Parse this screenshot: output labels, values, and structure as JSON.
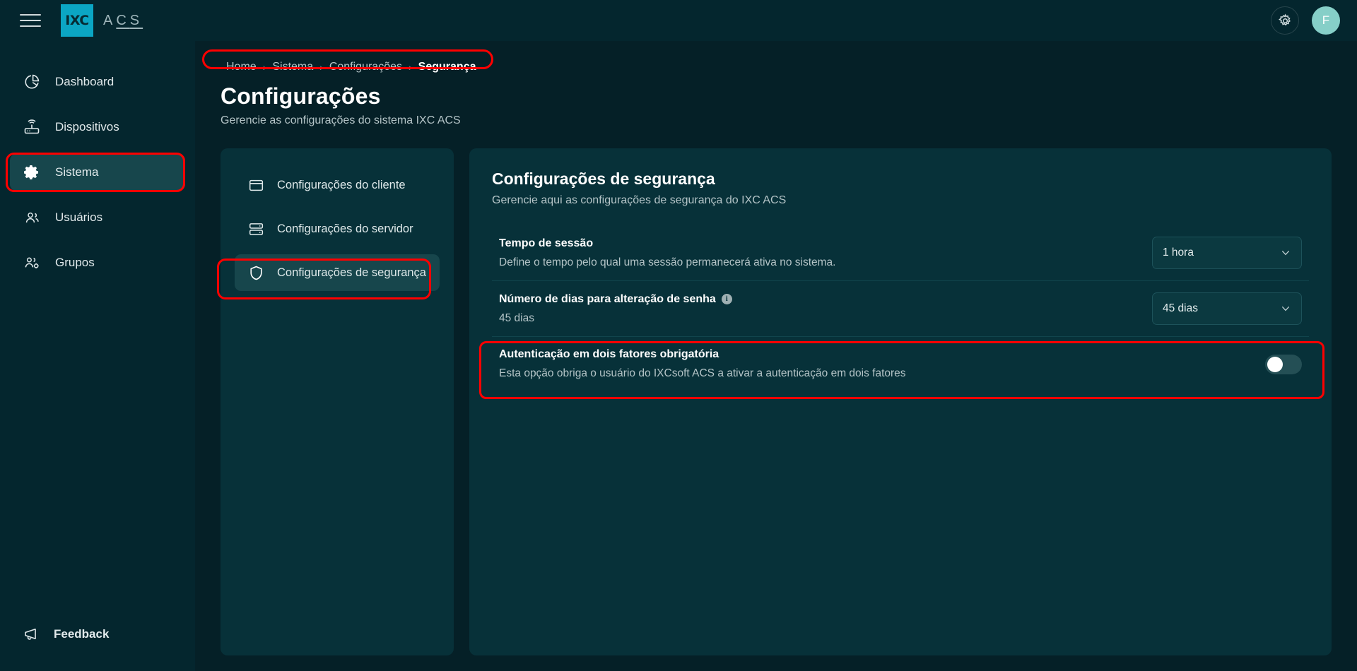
{
  "topbar": {
    "menu_icon": "hamburger-icon",
    "logo_mark": "IXC",
    "logo_text_a": "A",
    "logo_text_c": "C",
    "logo_text_s": "S",
    "settings_icon": "gear-icon",
    "avatar_initial": "F"
  },
  "sidebar": {
    "items": [
      {
        "label": "Dashboard",
        "icon": "pie-chart-icon",
        "active": false
      },
      {
        "label": "Dispositivos",
        "icon": "router-icon",
        "active": false
      },
      {
        "label": "Sistema",
        "icon": "gear-icon",
        "active": true
      },
      {
        "label": "Usuários",
        "icon": "users-icon",
        "active": false
      },
      {
        "label": "Grupos",
        "icon": "users-gear-icon",
        "active": false
      }
    ],
    "feedback": {
      "label": "Feedback",
      "icon": "megaphone-icon"
    }
  },
  "breadcrumb": {
    "items": [
      "Home",
      "Sistema",
      "Configurações",
      "Segurança"
    ],
    "separator": "›"
  },
  "page": {
    "title": "Configurações",
    "subtitle": "Gerencie as configurações do sistema IXC ACS"
  },
  "settings_menu": {
    "items": [
      {
        "label": "Configurações do cliente",
        "icon": "window-icon",
        "active": false
      },
      {
        "label": "Configurações do servidor",
        "icon": "server-icon",
        "active": false
      },
      {
        "label": "Configurações de segurança",
        "icon": "shield-icon",
        "active": true
      }
    ]
  },
  "detail": {
    "title": "Configurações de segurança",
    "subtitle": "Gerencie aqui as configurações de segurança do IXC ACS",
    "rows": [
      {
        "label": "Tempo de sessão",
        "description": "Define o tempo pelo qual uma sessão permanecerá ativa no sistema.",
        "control": "select",
        "value": "1 hora",
        "has_info": false
      },
      {
        "label": "Número de dias para alteração de senha",
        "description": "45 dias",
        "control": "select",
        "value": "45 dias",
        "has_info": true,
        "info_glyph": "i"
      },
      {
        "label": "Autenticação em dois fatores obrigatória",
        "description": "Esta opção obriga o usuário do IXCsoft ACS a ativar a autenticação em dois fatores",
        "control": "toggle",
        "value": "off",
        "has_info": false
      }
    ]
  },
  "colors": {
    "page_bg": "#052027",
    "panel_bg": "#073139",
    "chrome_bg": "#04262e",
    "accent_cyan": "#0ba6c4",
    "active_item": "#17464c",
    "avatar_bg": "#86cfc8",
    "annotation_red": "#ff0000",
    "text_primary": "#ffffff",
    "text_secondary": "#b4c4c7"
  },
  "annotations": [
    {
      "target": "breadcrumb",
      "color": "#ff0000"
    },
    {
      "target": "sidebar-item-sistema",
      "color": "#ff0000"
    },
    {
      "target": "menu-item-seguranca",
      "color": "#ff0000"
    },
    {
      "target": "row-two-factor-auth",
      "color": "#ff0000"
    }
  ]
}
